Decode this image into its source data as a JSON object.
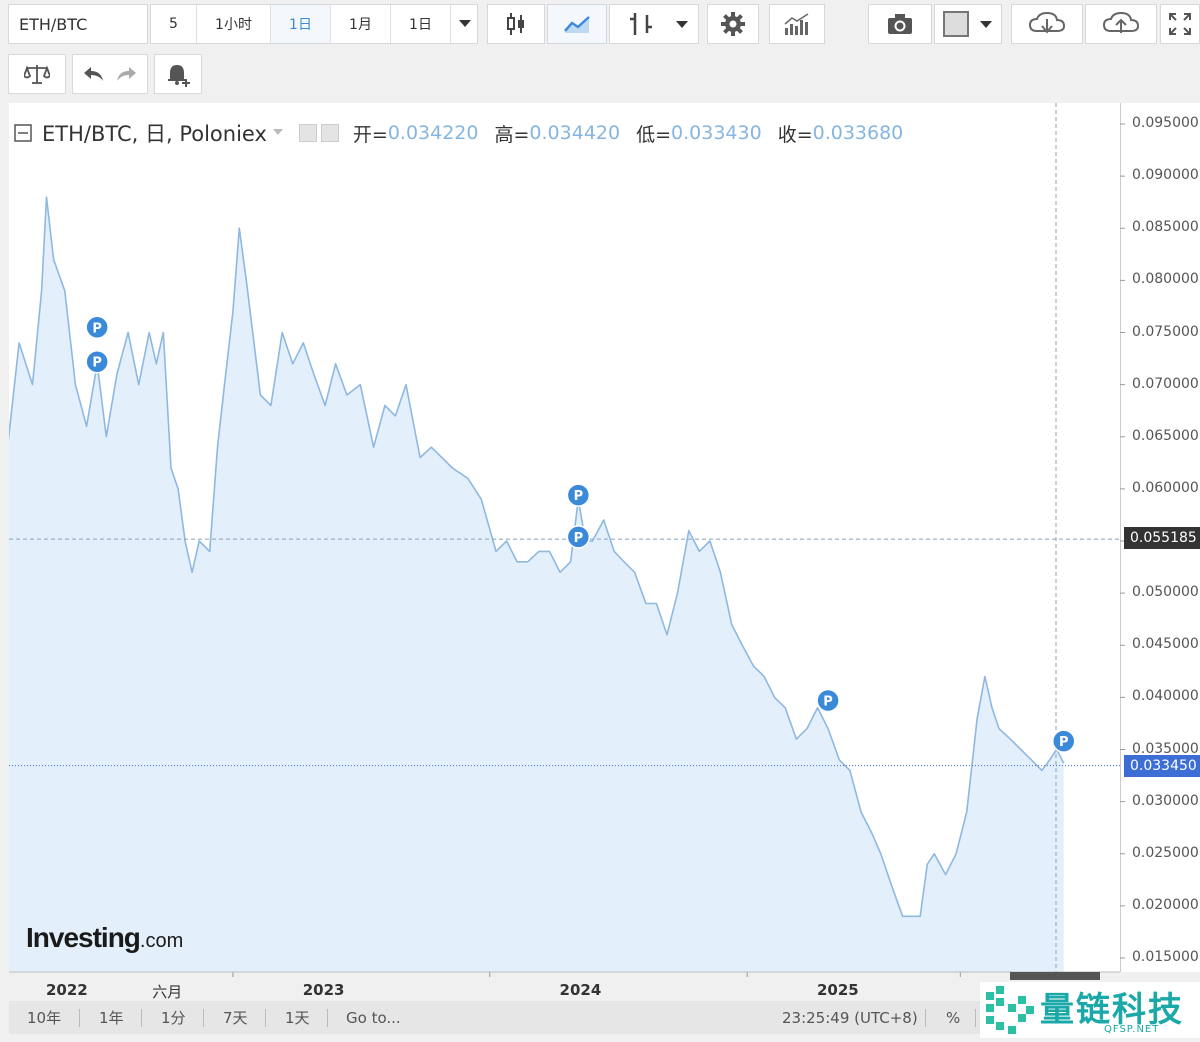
{
  "toolbar": {
    "symbol": "ETH/BTC",
    "interval_buttons": [
      "5",
      "1小时",
      "1日",
      "1月",
      "1日"
    ],
    "active_interval": "1日"
  },
  "legend": {
    "title": "ETH/BTC, 日, Poloniex",
    "open_label": "开=",
    "open": "0.034220",
    "high_label": "高=",
    "high": "0.034420",
    "low_label": "低=",
    "low": "0.033430",
    "close_label": "收=",
    "close": "0.033680"
  },
  "crosshair_price": "0.055185",
  "last_price": "0.033450",
  "colors": {
    "line": "#8fb8e0",
    "fill": "#e3f0fb",
    "last_tag": "#3d6ed6",
    "crosshair_tag": "#333333",
    "pin": "#3b8ad9"
  },
  "watermark": {
    "brand": "Investing",
    "suffix": ".com"
  },
  "bottom": {
    "ranges": [
      "10年",
      "1年",
      "1分",
      "7天",
      "1天",
      "Go to..."
    ],
    "time": "23:25:49 (UTC+8)",
    "percent": "%"
  },
  "logo": {
    "name": "量链科技",
    "sub": "QFSP.NET"
  },
  "chart_data": {
    "type": "area",
    "title": "",
    "xlabel": "",
    "ylabel": "",
    "x_tick_labels": [
      "2022",
      "六月",
      "2023",
      "2024",
      "2025"
    ],
    "y_tick_labels": [
      "0.095000",
      "0.090000",
      "0.085000",
      "0.080000",
      "0.075000",
      "0.070000",
      "0.065000",
      "0.060000",
      "0.055000",
      "0.050000",
      "0.045000",
      "0.040000",
      "0.035000",
      "0.030000",
      "0.025000",
      "0.020000",
      "0.015000"
    ],
    "ylim": [
      0.012,
      0.096
    ],
    "grid": false,
    "series": [
      {
        "x": [
          "2021-10-14",
          "2021-11-01",
          "2021-11-20",
          "2021-12-03",
          "2021-12-10",
          "2021-12-20",
          "2022-01-05",
          "2022-01-20",
          "2022-02-05",
          "2022-02-20",
          "2022-03-05",
          "2022-03-20",
          "2022-04-05",
          "2022-04-20",
          "2022-05-05",
          "2022-05-15",
          "2022-05-25",
          "2022-06-05",
          "2022-06-15",
          "2022-06-25",
          "2022-07-05",
          "2022-07-15",
          "2022-07-30",
          "2022-08-10",
          "2022-08-20",
          "2022-09-01",
          "2022-09-10",
          "2022-09-20",
          "2022-10-10",
          "2022-10-25",
          "2022-11-10",
          "2022-11-25",
          "2022-12-10",
          "2022-12-25",
          "2023-01-10",
          "2023-01-25",
          "2023-02-10",
          "2023-03-01",
          "2023-03-20",
          "2023-04-05",
          "2023-04-20",
          "2023-05-05",
          "2023-05-25",
          "2023-06-10",
          "2023-06-25",
          "2023-07-10",
          "2023-08-01",
          "2023-08-20",
          "2023-09-10",
          "2023-09-25",
          "2023-10-10",
          "2023-10-25",
          "2023-11-10",
          "2023-11-25",
          "2023-12-10",
          "2023-12-25",
          "2024-01-05",
          "2024-01-15",
          "2024-01-25",
          "2024-02-10",
          "2024-02-25",
          "2024-03-10",
          "2024-03-25",
          "2024-04-10",
          "2024-04-25",
          "2024-05-10",
          "2024-05-25",
          "2024-06-10",
          "2024-06-25",
          "2024-07-10",
          "2024-07-25",
          "2024-08-10",
          "2024-08-25",
          "2024-09-10",
          "2024-09-25",
          "2024-10-10",
          "2024-10-25",
          "2024-11-10",
          "2024-11-25",
          "2024-12-10",
          "2024-12-25",
          "2025-01-10",
          "2025-01-25",
          "2025-02-10",
          "2025-02-25",
          "2025-03-10",
          "2025-03-25",
          "2025-04-10",
          "2025-04-25",
          "2025-05-05",
          "2025-05-15",
          "2025-05-25",
          "2025-06-10",
          "2025-06-25",
          "2025-07-10",
          "2025-07-25",
          "2025-08-05",
          "2025-08-15",
          "2025-08-25",
          "2025-09-10",
          "2025-09-25",
          "2025-10-10",
          "2025-10-25",
          "2025-11-05",
          "2025-11-15",
          "2025-11-25"
        ],
        "y": [
          0.063,
          0.074,
          0.07,
          0.079,
          0.088,
          0.082,
          0.079,
          0.07,
          0.066,
          0.072,
          0.065,
          0.071,
          0.075,
          0.07,
          0.075,
          0.072,
          0.075,
          0.062,
          0.06,
          0.055,
          0.052,
          0.055,
          0.054,
          0.064,
          0.07,
          0.077,
          0.085,
          0.08,
          0.069,
          0.068,
          0.075,
          0.072,
          0.074,
          0.071,
          0.068,
          0.072,
          0.069,
          0.07,
          0.064,
          0.068,
          0.067,
          0.07,
          0.063,
          0.064,
          0.063,
          0.062,
          0.061,
          0.059,
          0.054,
          0.055,
          0.053,
          0.053,
          0.054,
          0.054,
          0.052,
          0.053,
          0.059,
          0.055,
          0.055,
          0.057,
          0.054,
          0.053,
          0.052,
          0.049,
          0.049,
          0.046,
          0.05,
          0.056,
          0.054,
          0.055,
          0.052,
          0.047,
          0.045,
          0.043,
          0.042,
          0.04,
          0.039,
          0.036,
          0.037,
          0.039,
          0.037,
          0.034,
          0.033,
          0.029,
          0.027,
          0.025,
          0.022,
          0.019,
          0.019,
          0.019,
          0.024,
          0.025,
          0.023,
          0.025,
          0.029,
          0.038,
          0.042,
          0.039,
          0.037,
          0.036,
          0.035,
          0.034,
          0.033,
          0.034,
          0.035,
          0.0337
        ]
      }
    ],
    "pin_label": "P",
    "pins": [
      {
        "x": "2022-02-20",
        "y": 0.0755
      },
      {
        "x": "2022-02-20",
        "y": 0.0722
      },
      {
        "x": "2024-01-05",
        "y": 0.0594
      },
      {
        "x": "2024-01-05",
        "y": 0.0554
      },
      {
        "x": "2024-12-25",
        "y": 0.0397
      },
      {
        "x": "2025-11-25",
        "y": 0.0358
      }
    ]
  }
}
